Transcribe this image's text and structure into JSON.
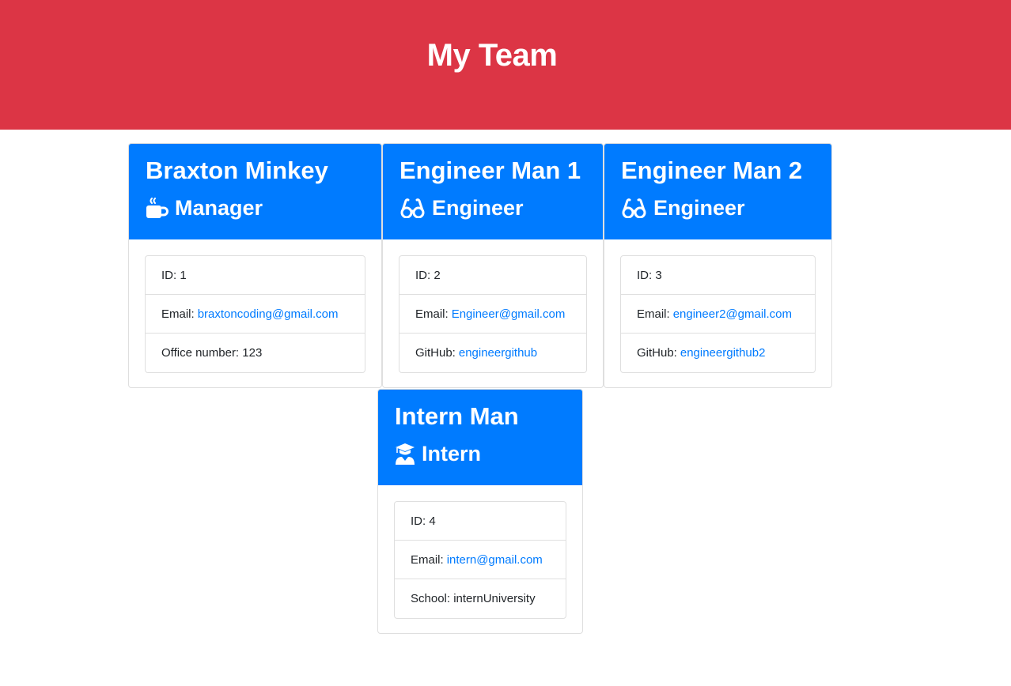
{
  "header": {
    "title": "My Team"
  },
  "colors": {
    "header_bg": "#dc3545",
    "card_header_bg": "#007bff",
    "link": "#007bff"
  },
  "cards": [
    {
      "name": "Braxton Minkey",
      "role": "Manager",
      "role_icon": "coffee-mug-icon",
      "id_label": "ID: 1",
      "email_label": "Email:",
      "email": "braxtoncoding@gmail.com",
      "extra_label": "Office number: 123",
      "extra_link": ""
    },
    {
      "name": "Engineer Man 1",
      "role": "Engineer",
      "role_icon": "glasses-icon",
      "id_label": "ID: 2",
      "email_label": "Email:",
      "email": "Engineer@gmail.com",
      "extra_label": "GitHub:",
      "extra_link": "engineergithub"
    },
    {
      "name": "Engineer Man 2",
      "role": "Engineer",
      "role_icon": "glasses-icon",
      "id_label": "ID: 3",
      "email_label": "Email:",
      "email": "engineer2@gmail.com",
      "extra_label": "GitHub:",
      "extra_link": "engineergithub2"
    },
    {
      "name": "Intern Man",
      "role": "Intern",
      "role_icon": "graduate-icon",
      "id_label": "ID: 4",
      "email_label": "Email:",
      "email": "intern@gmail.com",
      "extra_label": "School: internUniversity",
      "extra_link": ""
    }
  ]
}
